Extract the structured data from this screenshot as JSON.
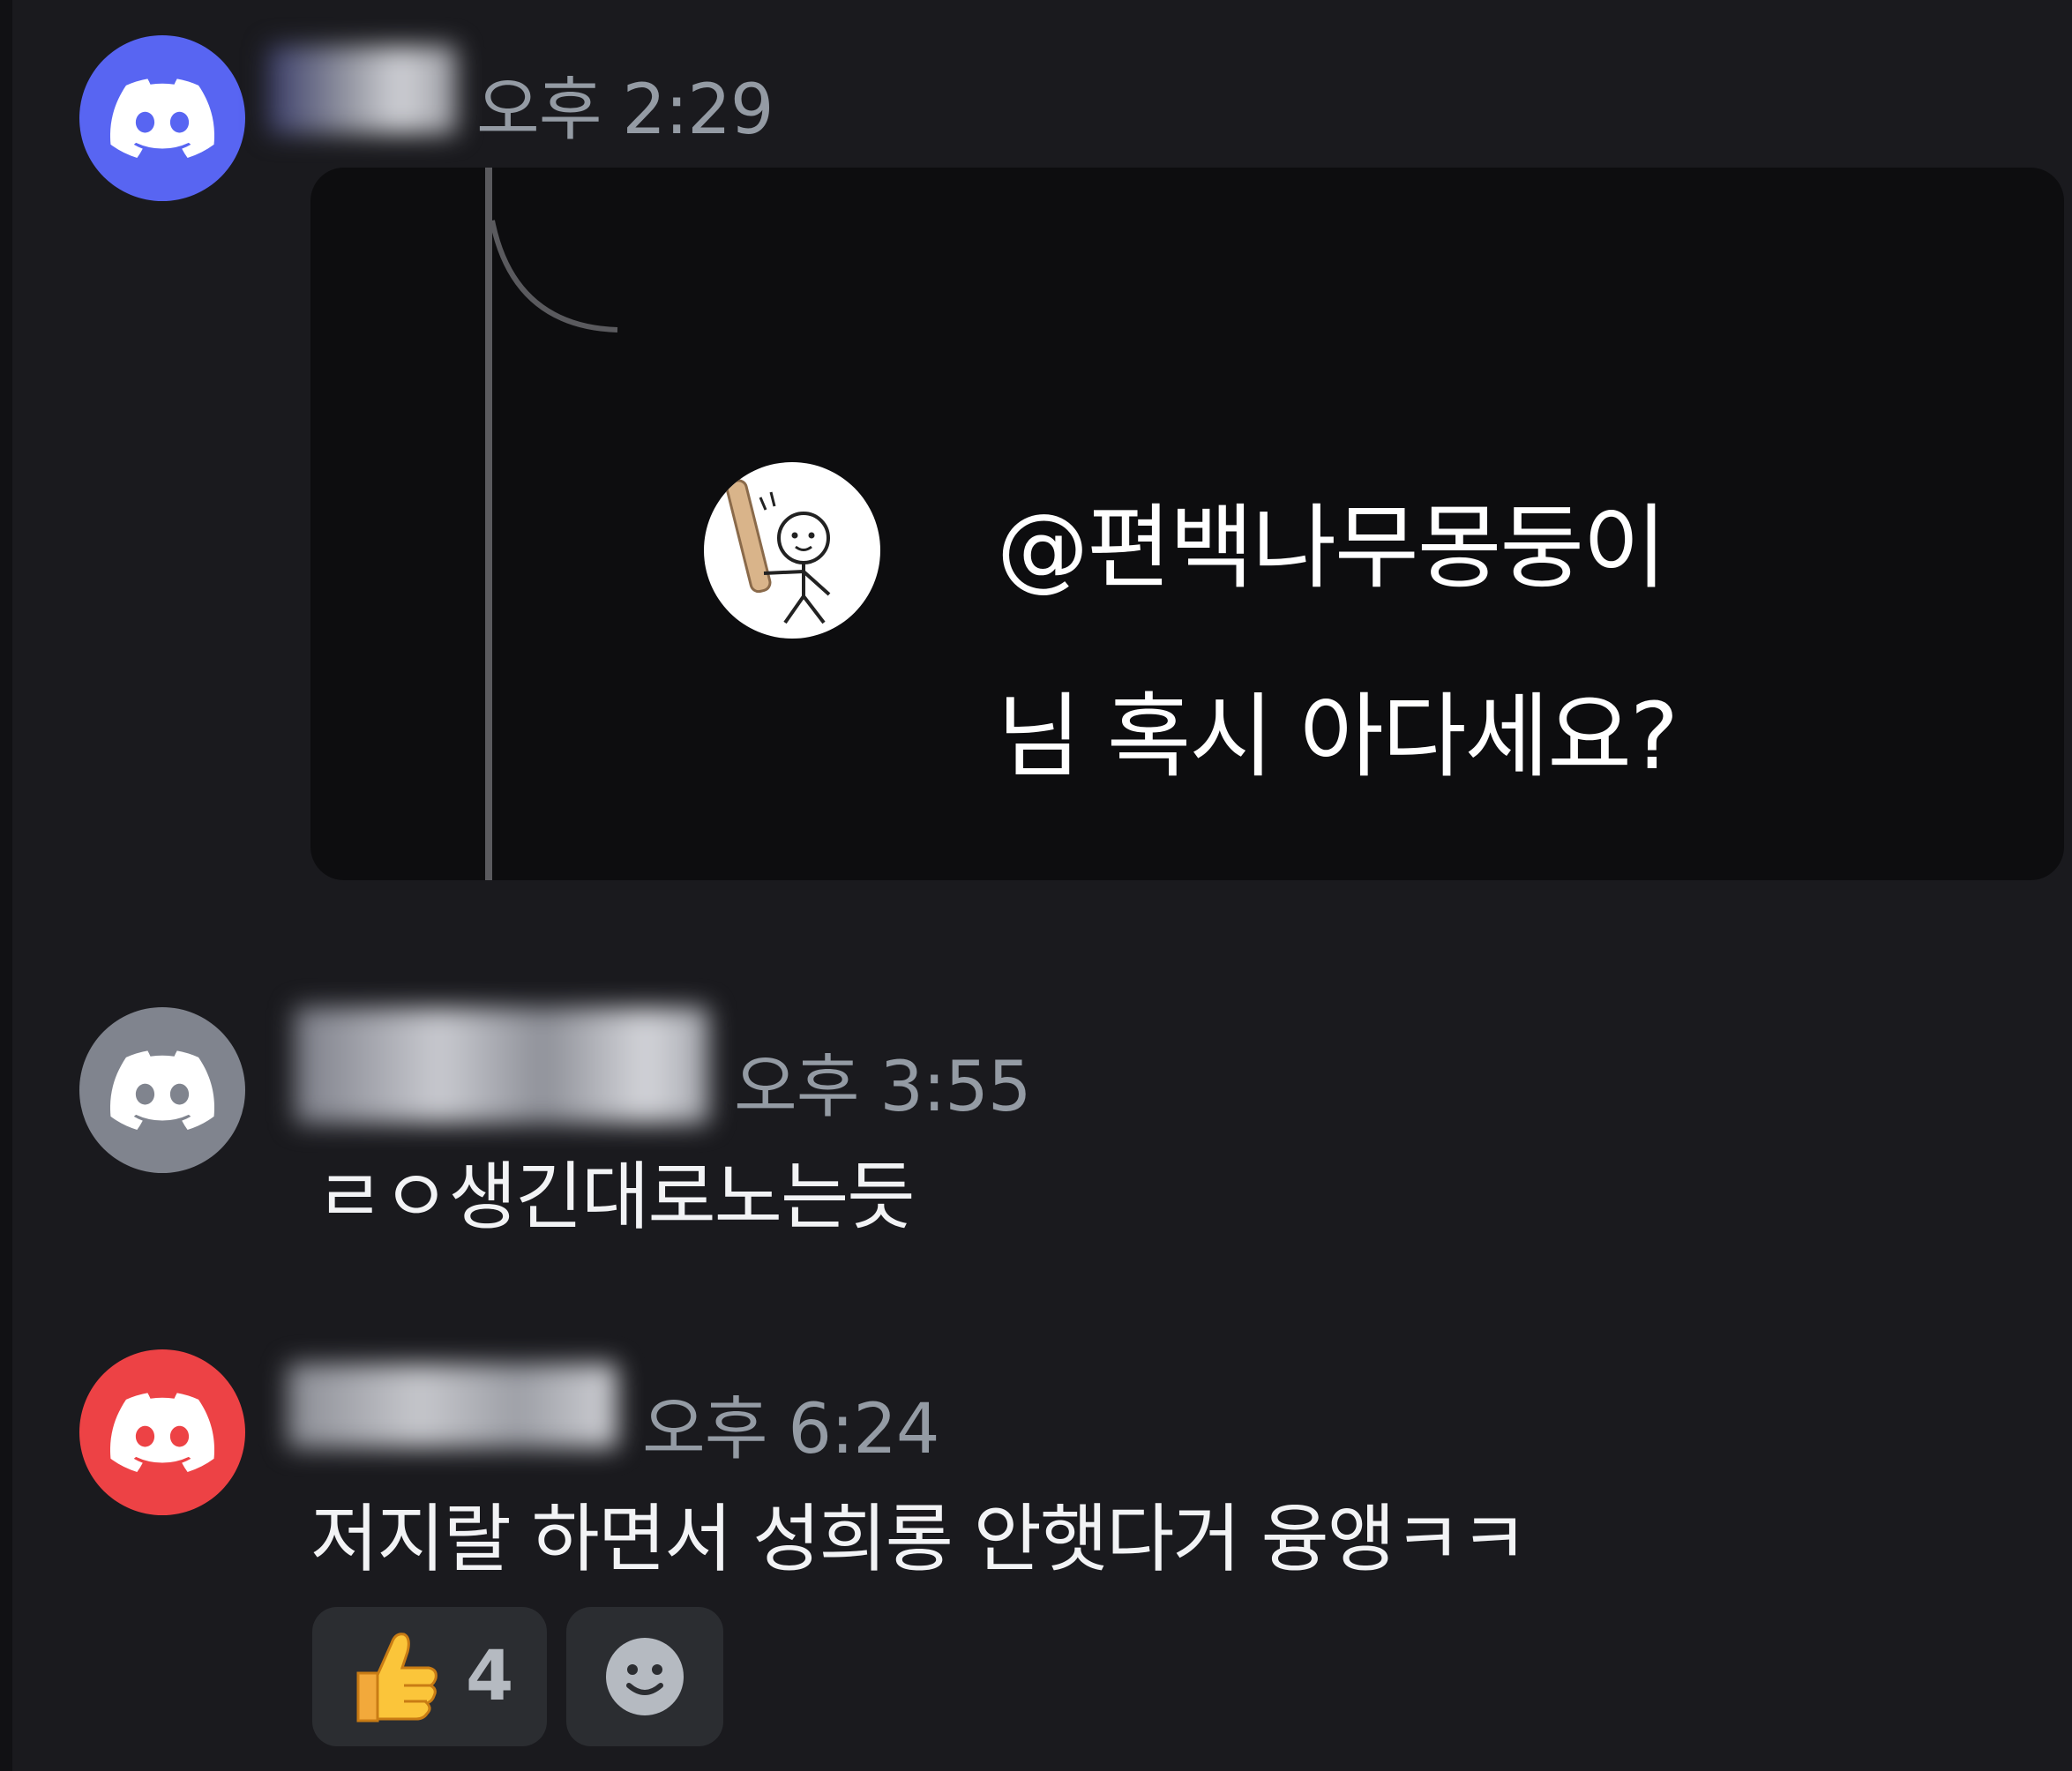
{
  "messages": [
    {
      "avatar_color": "#5865f2",
      "timestamp": "오후 2:29",
      "attachment": {
        "mention": "@편백나무몽둥이",
        "text": "님 혹시 아다세요?"
      }
    },
    {
      "avatar_color": "#80848e",
      "timestamp": "오후 3:55",
      "text": "ㄹㅇ생긴대로노는듯"
    },
    {
      "avatar_color": "#ed4245",
      "timestamp": "오후 6:24",
      "text": "저지랄 하면서 성희롱 안햇다거 융앵ㅋㅋ",
      "reactions": [
        {
          "emoji": "thumbs-up-icon",
          "count": "4"
        },
        {
          "emoji": "add-reaction-smiley-icon"
        }
      ]
    }
  ],
  "colors": {
    "background": "#1a1a1e",
    "timestamp": "#949ba4",
    "text": "#f2f3f5",
    "reaction_bg": "#2b2d31"
  }
}
